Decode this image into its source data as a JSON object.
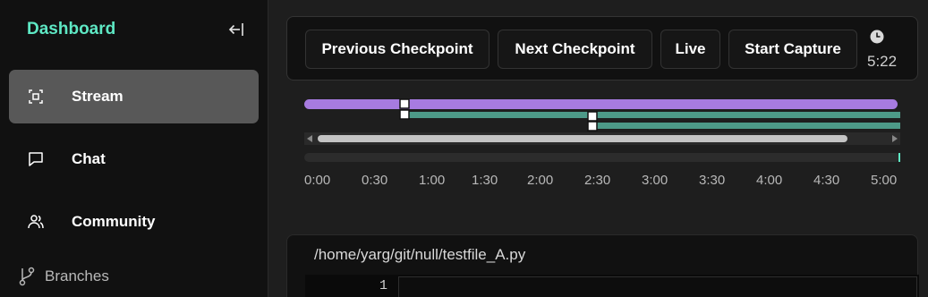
{
  "sidebar": {
    "brand": "Dashboard",
    "collapse_icon": "collapse-left-icon",
    "items": [
      {
        "label": "Stream",
        "icon": "stream-icon",
        "active": true
      },
      {
        "label": "Chat",
        "icon": "chat-icon",
        "active": false
      },
      {
        "label": "Community",
        "icon": "community-icon",
        "active": false
      },
      {
        "label": "Branches",
        "icon": "branch-icon",
        "active": false
      }
    ]
  },
  "toolbar": {
    "previous_label": "Previous Checkpoint",
    "next_label": "Next Checkpoint",
    "live_label": "Live",
    "capture_label": "Start Capture",
    "clock_icon": "clock-icon",
    "elapsed": "5:22"
  },
  "timeline": {
    "ticks": [
      "0:00",
      "0:30",
      "1:00",
      "1:30",
      "2:00",
      "2:30",
      "3:00",
      "3:30",
      "4:00",
      "4:30",
      "5:00"
    ],
    "checkpoints": [
      "0:45",
      "2:30"
    ],
    "colors": {
      "main_branch": "#a77be0",
      "sub_branch": "#4d9a88",
      "accent": "#5ee8c4"
    }
  },
  "editor": {
    "file_path": "/home/yarg/git/null/testfile_A.py",
    "line_number": "1"
  }
}
